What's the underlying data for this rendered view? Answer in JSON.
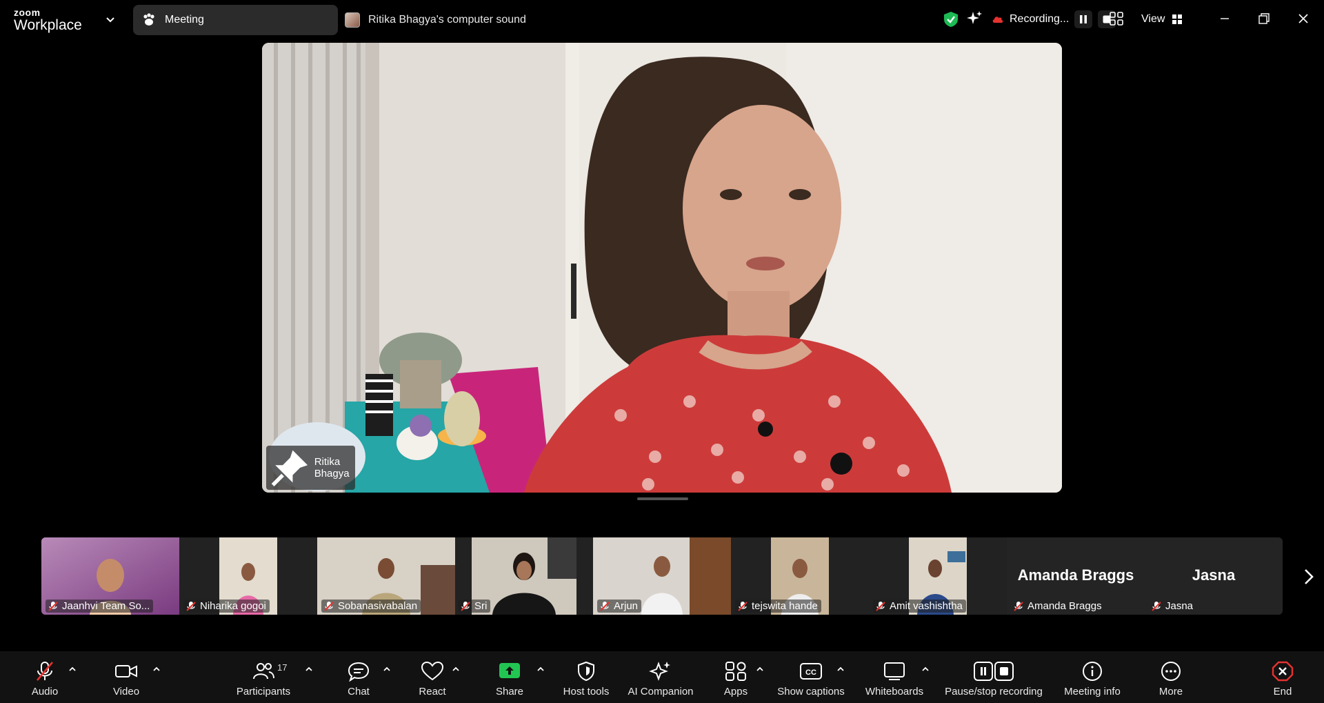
{
  "titlebar": {
    "logo_small": "zoom",
    "logo_big": "Workplace",
    "tab_meeting_label": "Meeting",
    "share_source_label": "Ritika Bhagya's computer sound",
    "recording_label": "Recording...",
    "view_label": "View"
  },
  "main_video": {
    "speaker_name": "Ritika Bhagya"
  },
  "filmstrip": {
    "participants": [
      {
        "name": "Jaanhvi Team So...",
        "muted": true
      },
      {
        "name": "Niharika gogoi",
        "muted": true
      },
      {
        "name": "Sobanasivabalan",
        "muted": true
      },
      {
        "name": "Sri",
        "muted": true
      },
      {
        "name": "Arjun",
        "muted": true
      },
      {
        "name": "tejswita hande",
        "muted": true
      },
      {
        "name": "Amit vashishtha",
        "muted": true
      },
      {
        "name": "Amanda Braggs",
        "muted": true,
        "display_name": "Amanda Braggs"
      },
      {
        "name": "Jasna",
        "muted": true,
        "display_name": "Jasna"
      }
    ]
  },
  "toolbar": {
    "audio": "Audio",
    "video": "Video",
    "participants": "Participants",
    "participants_count": "17",
    "chat": "Chat",
    "react": "React",
    "share": "Share",
    "host_tools": "Host tools",
    "ai_companion": "AI Companion",
    "apps": "Apps",
    "show_captions": "Show captions",
    "whiteboards": "Whiteboards",
    "pause_stop_recording": "Pause/stop recording",
    "meeting_info": "Meeting info",
    "more": "More",
    "end": "End"
  },
  "colors": {
    "share_green": "#23c552",
    "shield_green": "#1db954",
    "end_red": "#e5322f",
    "mute_red": "#e5322f",
    "toolbar_bg": "#121212"
  }
}
